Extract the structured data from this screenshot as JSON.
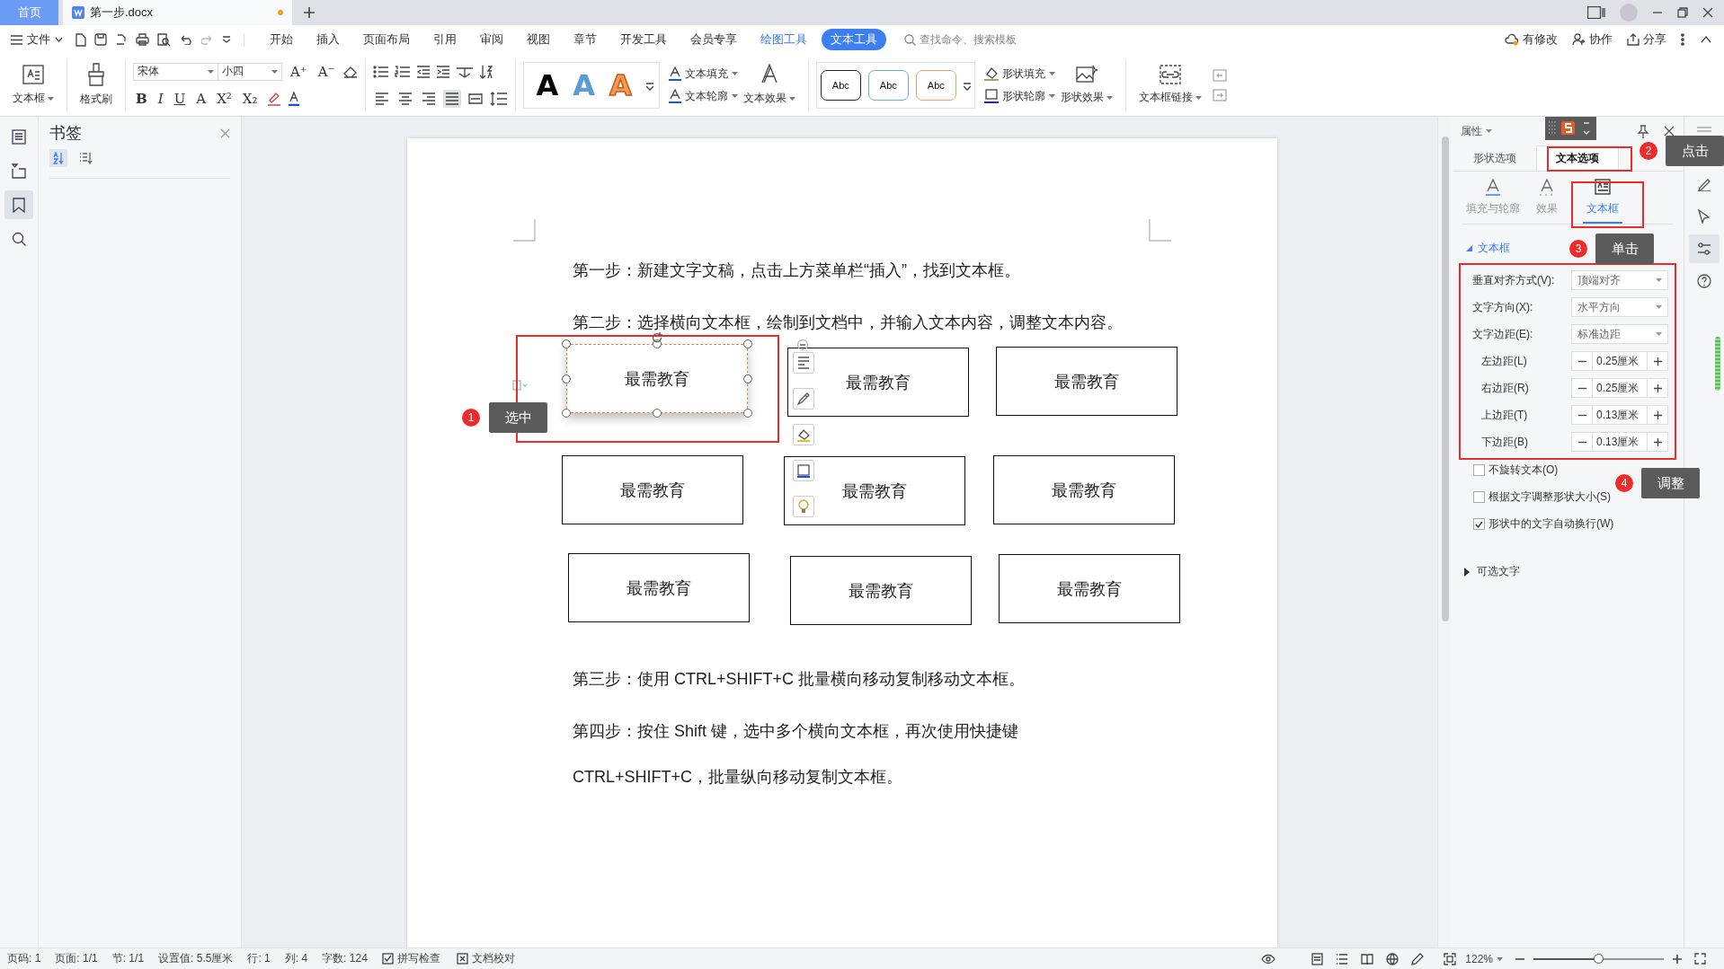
{
  "title_bar": {
    "tabs": [
      {
        "label": "首页",
        "kind": "home",
        "selected": false
      },
      {
        "label": "第一步.docx",
        "kind": "document",
        "selected": true,
        "modified": true
      }
    ]
  },
  "menu": {
    "file": "文件",
    "items": [
      {
        "label": "开始",
        "kind": "tab",
        "selected": false
      },
      {
        "label": "插入",
        "kind": "tab",
        "selected": false
      },
      {
        "label": "页面布局",
        "kind": "tab",
        "selected": false
      },
      {
        "label": "引用",
        "kind": "tab",
        "selected": false
      },
      {
        "label": "审阅",
        "kind": "tab",
        "selected": false
      },
      {
        "label": "视图",
        "kind": "tab",
        "selected": false
      },
      {
        "label": "章节",
        "kind": "tab",
        "selected": false
      },
      {
        "label": "开发工具",
        "kind": "tab",
        "selected": false
      },
      {
        "label": "会员专享",
        "kind": "tab",
        "selected": false
      },
      {
        "label": "绘图工具",
        "kind": "context",
        "selected": false
      },
      {
        "label": "文本工具",
        "kind": "context",
        "selected": true
      }
    ],
    "search": {
      "placeholder": "查找命令、搜索模板"
    },
    "actions": [
      {
        "label": "有修改",
        "kind": "cloud"
      },
      {
        "label": "协作",
        "kind": "user"
      },
      {
        "label": "分享",
        "kind": "share"
      }
    ]
  },
  "ribbon": {
    "text_box": "文本框",
    "format_painter": "格式刷",
    "font": "宋体",
    "size": "小四",
    "font_buttons": [
      "A⁺",
      "A⁻"
    ],
    "format_buttons": [
      "B",
      "I",
      "U",
      "A",
      "X²",
      "X₂"
    ],
    "alignment": [
      {
        "kind": "left",
        "selected": false
      },
      {
        "kind": "center",
        "selected": false
      },
      {
        "kind": "right",
        "selected": false
      },
      {
        "kind": "justify",
        "selected": true
      },
      {
        "kind": "distributed",
        "selected": false
      }
    ],
    "art_styles": [
      {
        "label": "A",
        "kind": "black"
      },
      {
        "label": "A",
        "kind": "blue"
      },
      {
        "label": "A",
        "kind": "orange"
      }
    ],
    "text_fill": "文本填充",
    "text_outline": "文本轮廓",
    "text_effect": "文本效果",
    "shape_styles": [
      {
        "label": "Abc",
        "kind": "dark"
      },
      {
        "label": "Abc",
        "kind": "blue"
      },
      {
        "label": "Abc",
        "kind": "orange"
      }
    ],
    "shape_fill": "形状填充",
    "shape_outline": "形状轮廓",
    "shape_effect": "形状效果",
    "text_box_link": "文本框链接"
  },
  "nav": [
    {
      "kind": "outline",
      "selected": false
    },
    {
      "kind": "navigation",
      "selected": false
    },
    {
      "kind": "bookmark",
      "selected": true
    },
    {
      "kind": "search",
      "selected": false
    }
  ],
  "bookmarks": {
    "title": "书签",
    "sort": [
      {
        "kind": "alphabetical",
        "selected": true
      },
      {
        "kind": "position",
        "selected": false
      }
    ]
  },
  "document": {
    "paragraphs": [
      "第一步：新建文字文稿，点击上方菜单栏“插入”，找到文本框。",
      "第二步：选择横向文本框，绘制到文档中，并输入文本内容，调整文本内容。",
      "第三步：使用 CTRL+SHIFT+C 批量横向移动复制移动文本框。",
      "第四步：按住 Shift 键，选中多个横向文本框，再次使用快捷键",
      "CTRL+SHIFT+C，批量纵向移动复制文本框。"
    ],
    "text_boxes": [
      {
        "text": "最需教育",
        "selected": true
      },
      {
        "text": "最需教育",
        "selected": false
      },
      {
        "text": "最需教育",
        "selected": false
      },
      {
        "text": "最需教育",
        "selected": false
      },
      {
        "text": "最需教育",
        "selected": false
      },
      {
        "text": "最需教育",
        "selected": false
      },
      {
        "text": "最需教育",
        "selected": false
      },
      {
        "text": "最需教育",
        "selected": false
      },
      {
        "text": "最需教育",
        "selected": false
      }
    ]
  },
  "properties": {
    "title": "属性",
    "tabs": [
      {
        "label": "形状选项",
        "selected": false
      },
      {
        "label": "文本选项",
        "selected": true
      }
    ],
    "subtabs": [
      {
        "label": "填充与轮廓",
        "kind": "fill",
        "selected": false
      },
      {
        "label": "效果",
        "kind": "effect",
        "selected": false
      },
      {
        "label": "文本框",
        "kind": "textbox",
        "selected": true
      }
    ],
    "section": {
      "label": "文本框",
      "expanded": true
    },
    "dropdowns": [
      {
        "label": "垂直对齐方式(V):",
        "value": "顶端对齐"
      },
      {
        "label": "文字方向(X):",
        "value": "水平方向"
      },
      {
        "label": "文字边距(E):",
        "value": "标准边距"
      }
    ],
    "spinners": [
      {
        "label": "左边距(L)",
        "value": "0.25厘米"
      },
      {
        "label": "右边距(R)",
        "value": "0.25厘米"
      },
      {
        "label": "上边距(T)",
        "value": "0.13厘米"
      },
      {
        "label": "下边距(B)",
        "value": "0.13厘米"
      }
    ],
    "checkboxes": [
      {
        "label": "不旋转文本(O)",
        "checked": false
      },
      {
        "label": "根据文字调整形状大小(S)",
        "checked": false
      },
      {
        "label": "形状中的文字自动换行(W)",
        "checked": true
      }
    ],
    "alt_text": {
      "label": "可选文字",
      "expanded": false
    }
  },
  "right_bar": [
    {
      "kind": "brush",
      "selected": false
    },
    {
      "kind": "pointer",
      "selected": false
    },
    {
      "kind": "settings",
      "selected": true
    },
    {
      "kind": "help",
      "selected": false
    }
  ],
  "annotations": [
    {
      "number": "1",
      "label": "选中"
    },
    {
      "number": "2",
      "label": "点击"
    },
    {
      "number": "3",
      "label": "单击"
    },
    {
      "number": "4",
      "label": "调整"
    }
  ],
  "status_bar": {
    "items": [
      "页码: 1",
      "页面: 1/1",
      "节: 1/1",
      "设置值: 5.5厘米",
      "行: 1",
      "列: 4",
      "字数: 124"
    ],
    "tools": [
      {
        "label": "拼写检查",
        "kind": "check"
      },
      {
        "label": "文档校对",
        "kind": "proof"
      }
    ],
    "zoom": {
      "value": "122%",
      "level": 0.5
    }
  }
}
